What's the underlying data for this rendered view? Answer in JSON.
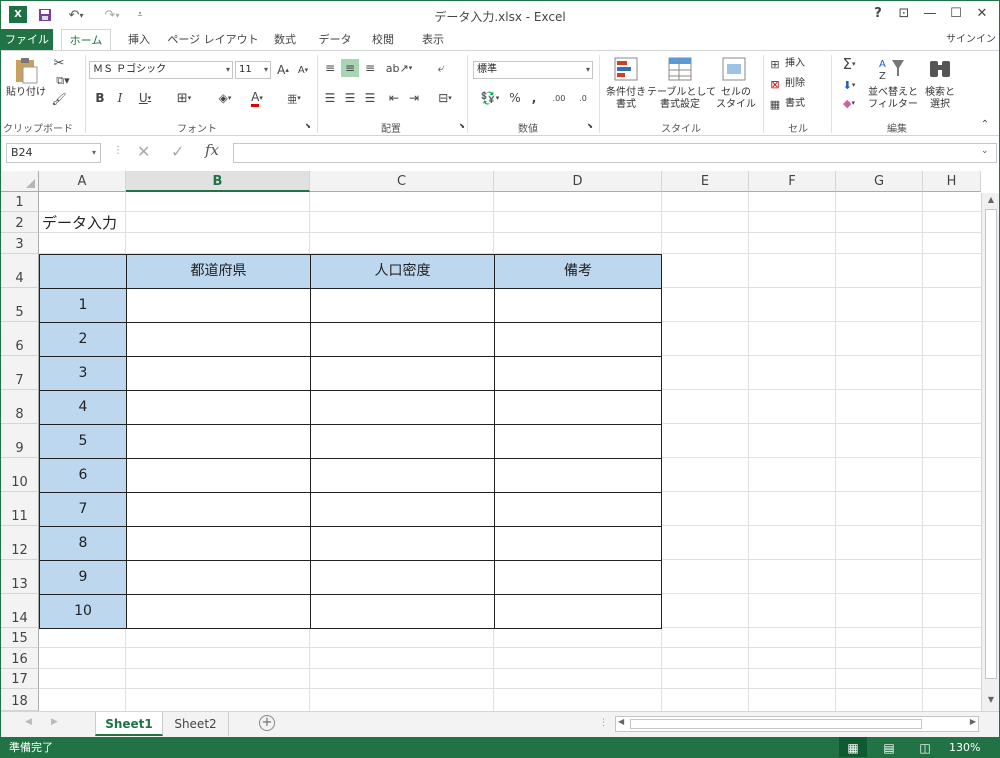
{
  "window": {
    "title": "データ入力.xlsx - Excel",
    "help": "?",
    "restore_ribbon": "⊡",
    "minimize": "—",
    "maximize": "☐",
    "close": "✕",
    "signin": "サインイン"
  },
  "tabs": [
    "ファイル",
    "ホーム",
    "挿入",
    "ページ レイアウト",
    "数式",
    "データ",
    "校閲",
    "表示"
  ],
  "ribbon": {
    "clipboard": {
      "paste": "貼り付け",
      "label": "クリップボード"
    },
    "font": {
      "name": "ＭＳ Ｐゴシック",
      "size": "11",
      "label": "フォント"
    },
    "alignment": {
      "label": "配置"
    },
    "number": {
      "format": "標準",
      "label": "数値"
    },
    "styles": {
      "conditional": "条件付き\n書式",
      "table": "テーブルとして\n書式設定",
      "cell": "セルの\nスタイル",
      "label": "スタイル"
    },
    "cells": {
      "insert": "挿入",
      "delete": "削除",
      "format": "書式",
      "label": "セル"
    },
    "editing": {
      "sort": "並べ替えと\nフィルター",
      "find": "検索と\n選択",
      "label": "編集"
    }
  },
  "formula_bar": {
    "name_box": "B24",
    "fx": "fx",
    "value": ""
  },
  "columns": [
    "A",
    "B",
    "C",
    "D",
    "E",
    "F",
    "G",
    "H"
  ],
  "selected_column": "B",
  "rows": [
    "1",
    "2",
    "3",
    "4",
    "5",
    "6",
    "7",
    "8",
    "9",
    "10",
    "11",
    "12",
    "13",
    "14",
    "15",
    "16",
    "17",
    "18"
  ],
  "sheet": {
    "title_cell": "データ入力",
    "headers": [
      "都道府県",
      "人口密度",
      "備考"
    ],
    "numbers": [
      "1",
      "2",
      "3",
      "4",
      "5",
      "6",
      "7",
      "8",
      "9",
      "10"
    ]
  },
  "sheet_tabs": [
    "Sheet1",
    "Sheet2"
  ],
  "active_sheet": "Sheet1",
  "status": {
    "ready": "準備完了",
    "zoom": "130%"
  },
  "colors": {
    "excel_green": "#217346",
    "table_header": "#bdd7ee"
  }
}
